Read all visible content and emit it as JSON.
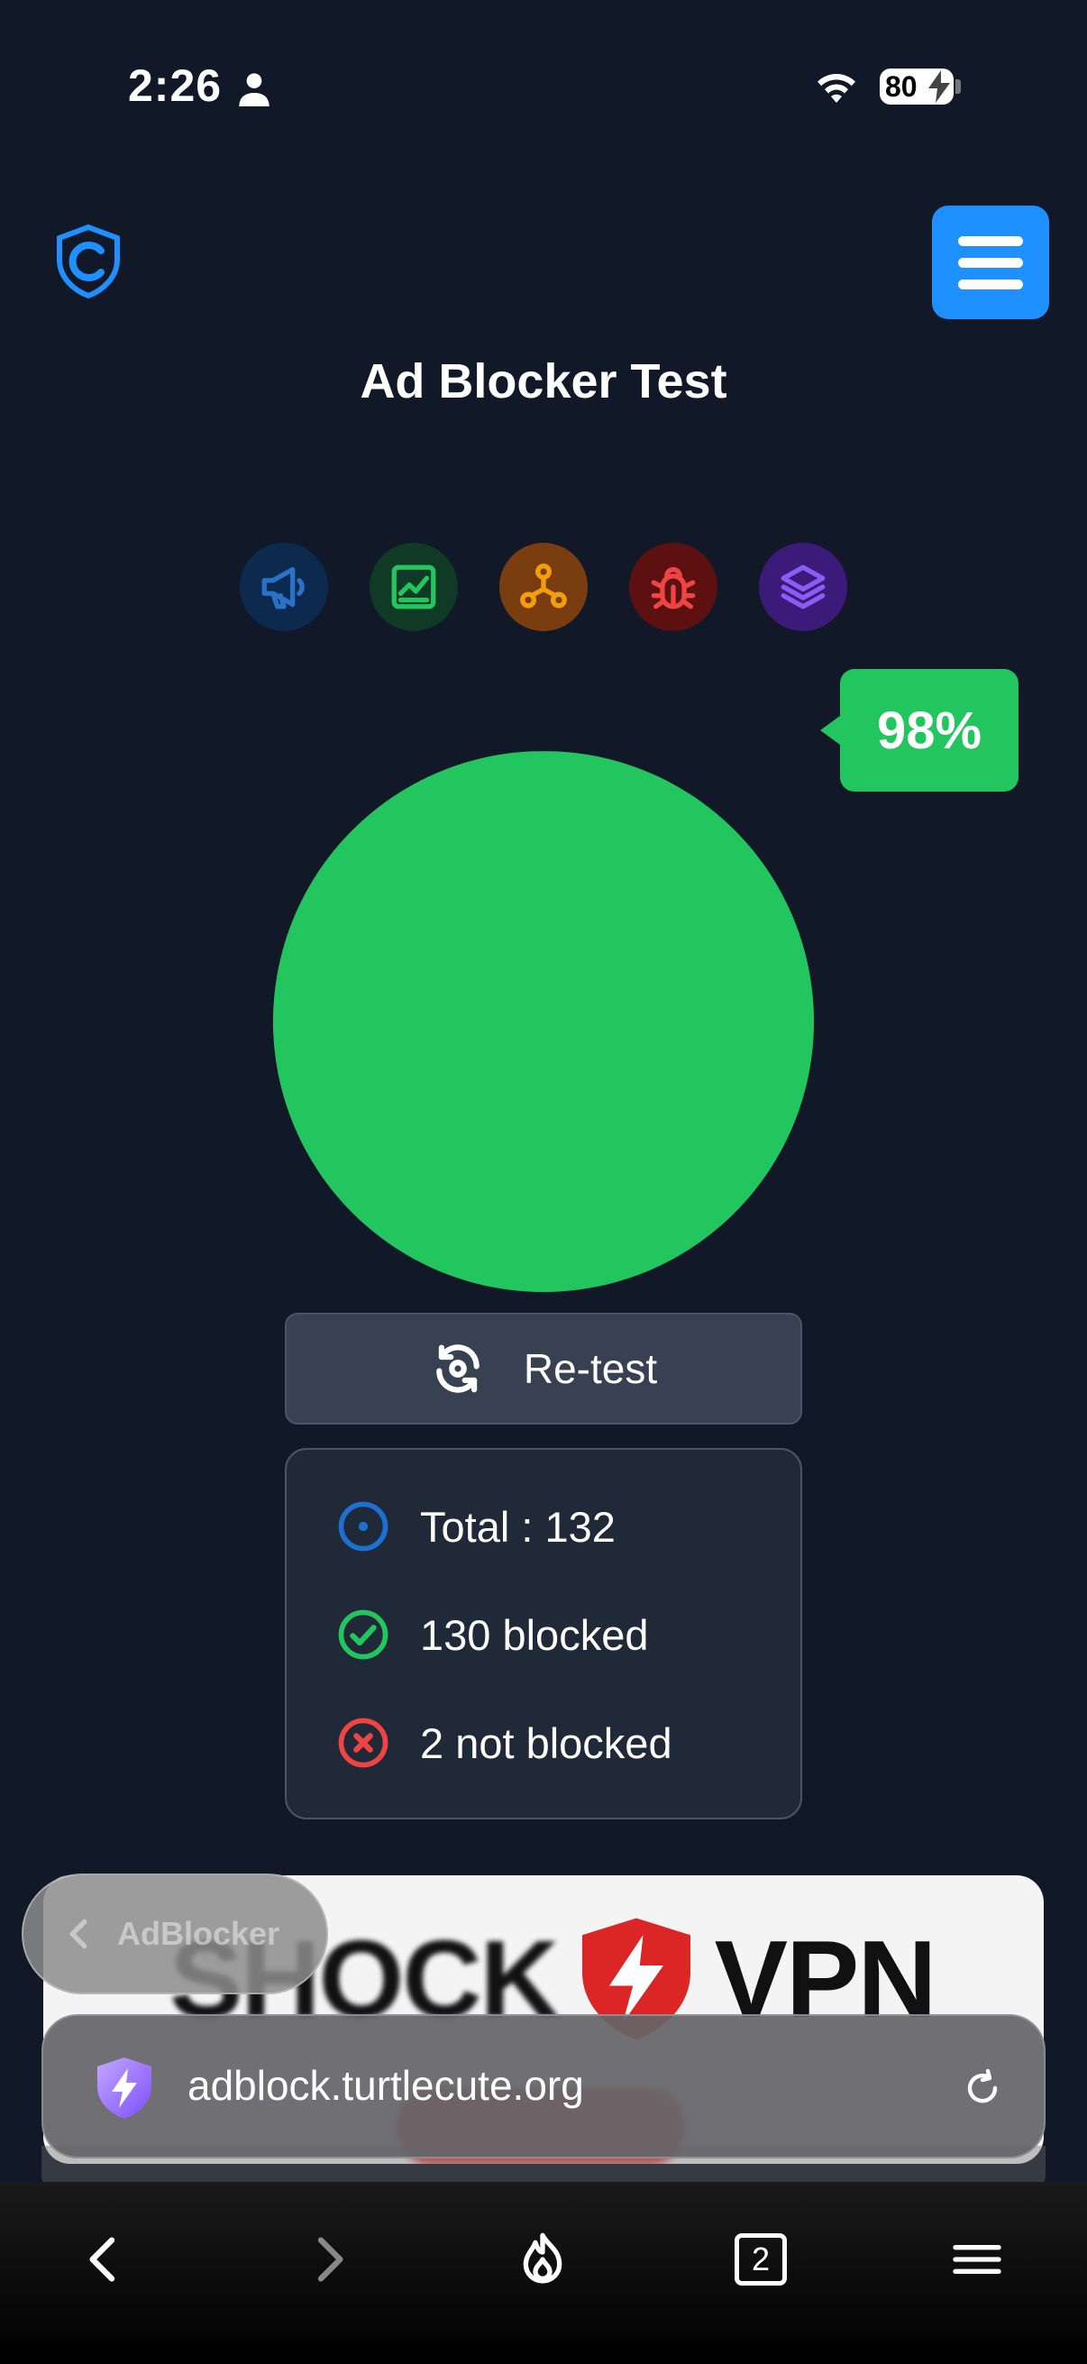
{
  "status_bar": {
    "time": "2:26",
    "battery": "80"
  },
  "page": {
    "title": "Ad Blocker Test"
  },
  "categories": [
    {
      "icon": "megaphone-icon",
      "bg": "#0b2a4d",
      "color": "#2a72c9"
    },
    {
      "icon": "chart-icon",
      "bg": "#0f3a25",
      "color": "#22c55e"
    },
    {
      "icon": "network-icon",
      "bg": "#7a3d0f",
      "color": "#f59e0b"
    },
    {
      "icon": "bug-icon",
      "bg": "#5c1010",
      "color": "#ef4444"
    },
    {
      "icon": "layers-icon",
      "bg": "#3b1a7a",
      "color": "#8b5cf6"
    }
  ],
  "result": {
    "percent": "98%",
    "blocked_fraction": 0.985,
    "pie_color": "#22c55e",
    "remainder_color": "#1f6b3c"
  },
  "retest": {
    "label": "Re-test"
  },
  "stats": {
    "total": "Total : 132",
    "blocked": "130 blocked",
    "not_blocked": "2 not blocked"
  },
  "banner": {
    "left": "SHOCK",
    "right": "VPN"
  },
  "back": {
    "label": "AdBlocker"
  },
  "url_bar": {
    "url": "adblock.turtlecute.org"
  },
  "toolbar": {
    "tab_count": "2"
  },
  "colors": {
    "background": "#111827",
    "accent": "#1e90ff",
    "success": "#22c55e",
    "danger": "#ef4444"
  }
}
